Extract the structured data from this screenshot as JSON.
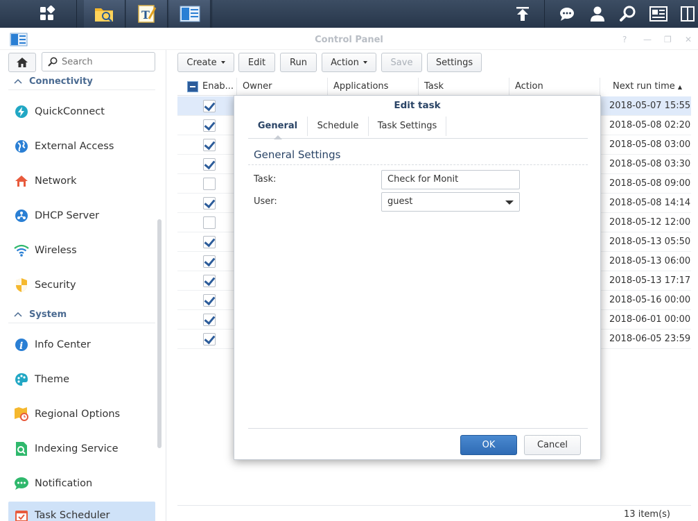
{
  "window": {
    "title": "Control Panel"
  },
  "sidebar": {
    "search_placeholder": "Search",
    "sections": [
      {
        "label": "Connectivity",
        "items": [
          "QuickConnect",
          "External Access",
          "Network",
          "DHCP Server",
          "Wireless",
          "Security"
        ]
      },
      {
        "label": "System",
        "items": [
          "Info Center",
          "Theme",
          "Regional Options",
          "Indexing Service",
          "Notification",
          "Task Scheduler"
        ]
      }
    ],
    "active_item": "Task Scheduler"
  },
  "toolbar": {
    "create": "Create",
    "edit": "Edit",
    "run": "Run",
    "action": "Action",
    "save": "Save",
    "settings": "Settings"
  },
  "grid": {
    "columns": [
      "Enab...",
      "Owner",
      "Applications",
      "Task",
      "Action",
      "Next run time"
    ],
    "rows": [
      {
        "enabled": true,
        "next_run": "2018-05-07 15:55"
      },
      {
        "enabled": true,
        "next_run": "2018-05-08 02:20"
      },
      {
        "enabled": true,
        "next_run": "2018-05-08 03:00"
      },
      {
        "enabled": true,
        "next_run": "2018-05-08 03:30"
      },
      {
        "enabled": false,
        "next_run": "2018-05-08 09:00"
      },
      {
        "enabled": true,
        "next_run": "2018-05-08 14:14"
      },
      {
        "enabled": false,
        "next_run": "2018-05-12 12:00"
      },
      {
        "enabled": true,
        "next_run": "2018-05-13 05:50"
      },
      {
        "enabled": true,
        "next_run": "2018-05-13 06:00"
      },
      {
        "enabled": true,
        "next_run": "2018-05-13 17:17"
      },
      {
        "enabled": true,
        "next_run": "2018-05-16 00:00"
      },
      {
        "enabled": true,
        "next_run": "2018-06-01 00:00"
      },
      {
        "enabled": true,
        "next_run": "2018-06-05 23:59"
      }
    ],
    "item_count": "13 item(s)"
  },
  "dialog": {
    "title": "Edit task",
    "tabs": [
      "General",
      "Schedule",
      "Task Settings"
    ],
    "active_tab": "General",
    "group_title": "General Settings",
    "task_label": "Task:",
    "task_value": "Check for Monit",
    "user_label": "User:",
    "user_value": "guest",
    "ok": "OK",
    "cancel": "Cancel"
  },
  "colors": {
    "accent": "#2e6bb5",
    "selection": "#cfe2f8",
    "taskbar": "#2f3f55"
  }
}
